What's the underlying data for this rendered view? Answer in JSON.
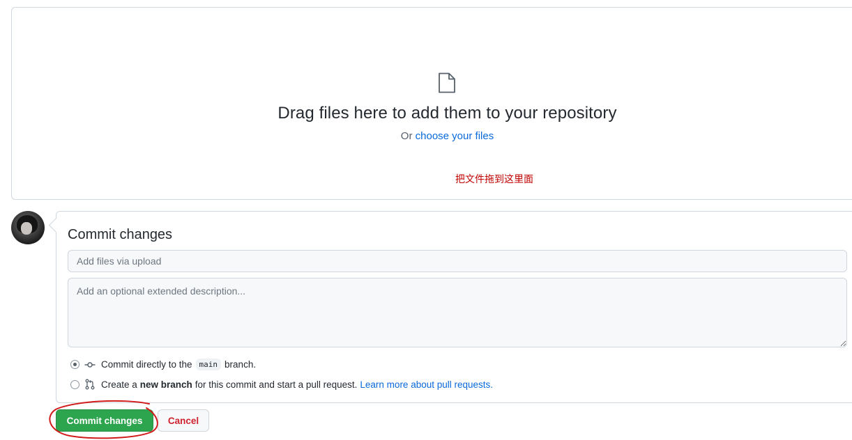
{
  "dropzone": {
    "icon": "file-icon",
    "title": "Drag files here to add them to your repository",
    "or_text": "Or",
    "choose_link": "choose your files",
    "annotation": "把文件拖到这里面",
    "annotation_color": "#c00000"
  },
  "commit": {
    "heading": "Commit changes",
    "summary_placeholder": "Add files via upload",
    "description_placeholder": "Add an optional extended description...",
    "option_direct": {
      "selected": true,
      "icon": "git-commit-icon",
      "text_before": "Commit directly to the",
      "branch": "main",
      "text_after": "branch."
    },
    "option_new_branch": {
      "selected": false,
      "icon": "git-pull-request-icon",
      "text_before": "Create a",
      "bold": "new branch",
      "text_after": "for this commit and start a pull request.",
      "link": "Learn more about pull requests."
    }
  },
  "buttons": {
    "commit_label": "Commit changes",
    "cancel_label": "Cancel"
  },
  "colors": {
    "accent_link": "#0969da",
    "primary_button": "#2da44e",
    "danger_text": "#cf222e",
    "annotation_scribble": "#d11a1a"
  }
}
